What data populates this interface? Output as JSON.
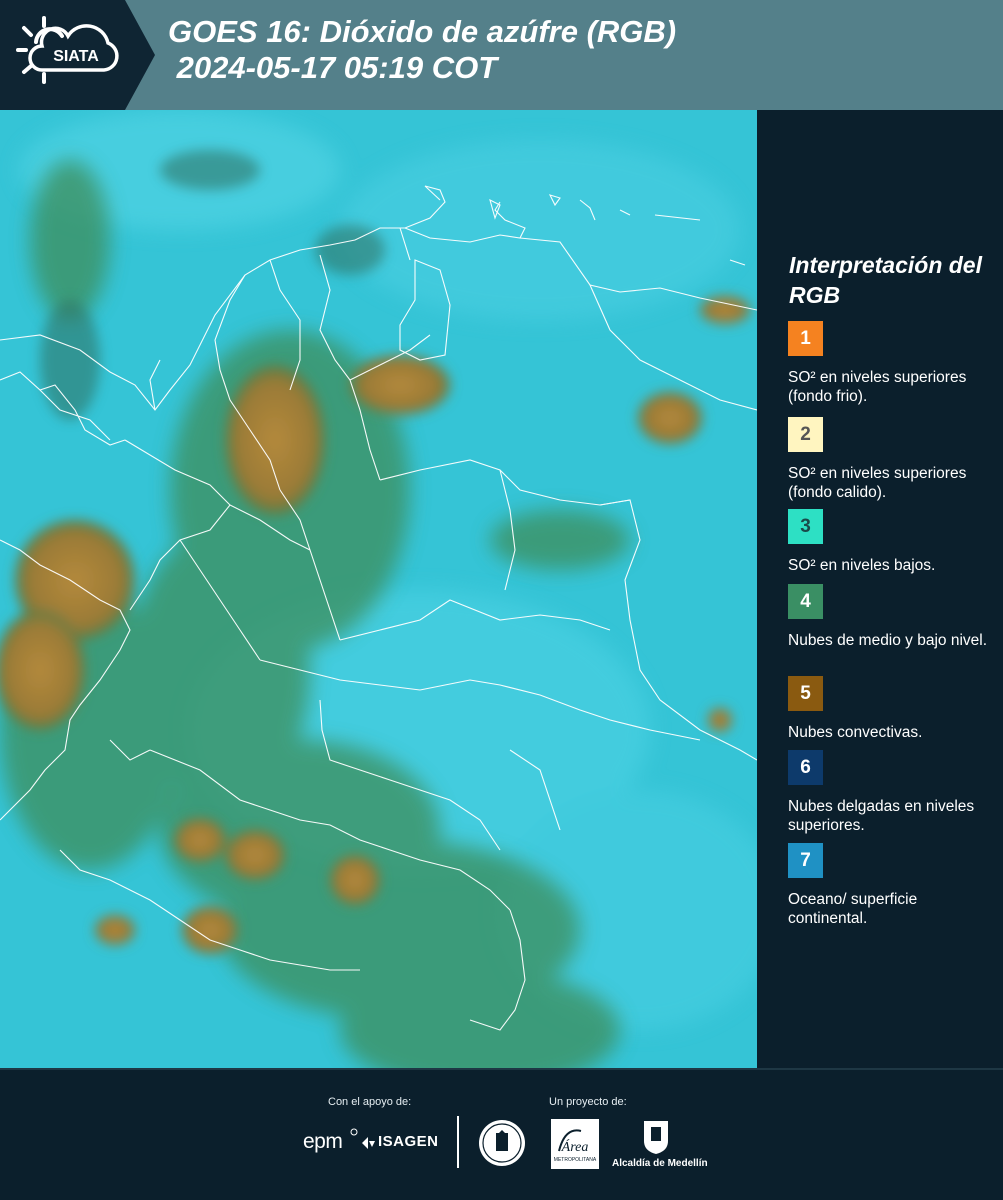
{
  "header": {
    "logo_text": "SIATA",
    "title_line1": "GOES 16: Dióxido de azúfre (RGB)",
    "title_line2": " 2024-05-17 05:19 COT"
  },
  "legend": {
    "title": "Interpretación del RGB",
    "items": [
      {
        "number": "1",
        "color": "#f58220",
        "text": "SO² en niveles superiores (fondo frio)."
      },
      {
        "number": "2",
        "color": "#fff5c0",
        "text": "SO² en niveles superiores (fondo calido)."
      },
      {
        "number": "3",
        "color": "#2de0c4",
        "text": "SO² en niveles bajos."
      },
      {
        "number": "4",
        "color": "#3a8f64",
        "text": "Nubes de medio y bajo nivel."
      },
      {
        "number": "5",
        "color": "#8a5a10",
        "text": "Nubes convectivas."
      },
      {
        "number": "6",
        "color": "#0d3a6b",
        "text": "Nubes delgadas en niveles superiores."
      },
      {
        "number": "7",
        "color": "#1f91c4",
        "text": "Oceano/ superficie continental."
      }
    ]
  },
  "footer": {
    "support_label": "Con el apoyo de:",
    "project_label": "Un proyecto de:",
    "sponsor_epm": "epm",
    "sponsor_isagen": "ISAGEN",
    "area_logo_text": "Área",
    "area_subtext": "METROPOLITANA",
    "alcaldia": "Alcaldía de Medellín"
  },
  "colors": {
    "background": "#0b1f2c",
    "header": "#54808a",
    "ocean_surface": "#33c3d5",
    "convective": "#a88a3a",
    "mid_low_cloud": "#3b8a5a"
  }
}
